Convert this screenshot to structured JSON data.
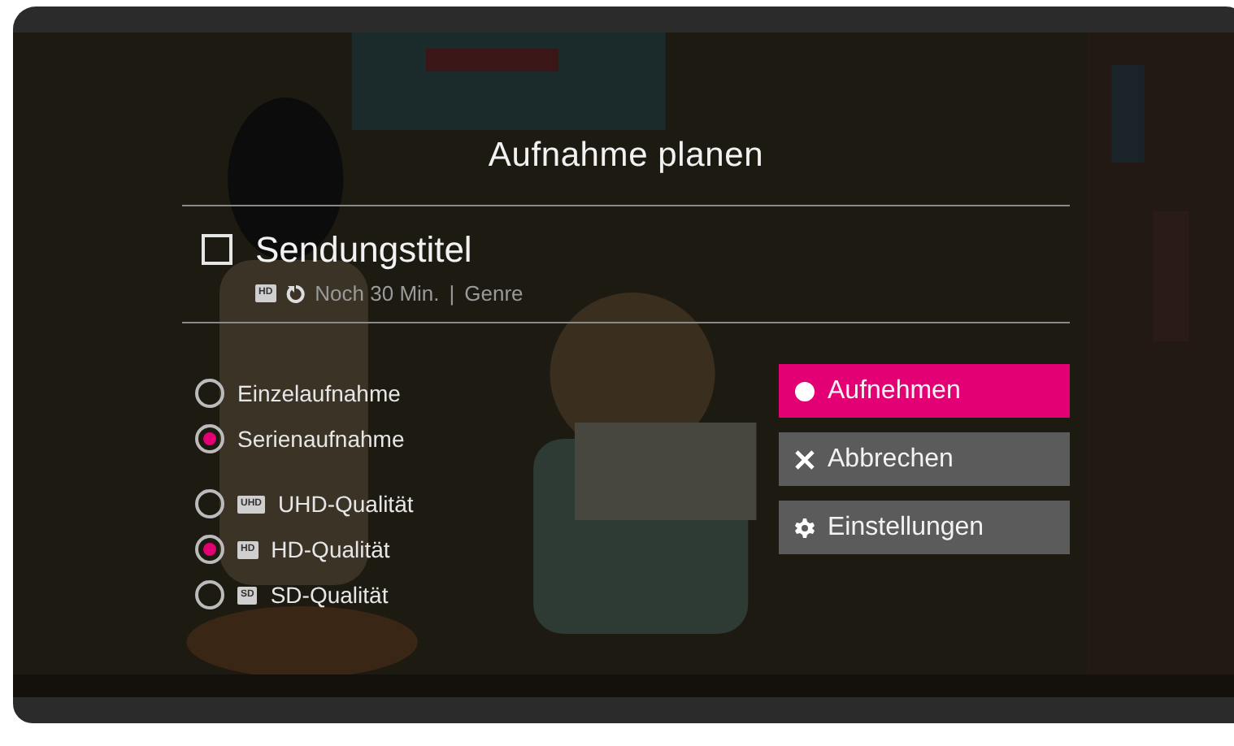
{
  "title": "Aufnahme planen",
  "program": {
    "checked": false,
    "title": "Sendungstitel",
    "badge": "HD",
    "remaining": "Noch 30 Min.",
    "separator": "|",
    "genre": "Genre"
  },
  "recording_types": [
    {
      "label": "Einzelaufnahme",
      "selected": false
    },
    {
      "label": "Serienaufnahme",
      "selected": true
    }
  ],
  "qualities": [
    {
      "badge": "UHD",
      "label": "UHD-Qualität",
      "selected": false
    },
    {
      "badge": "HD",
      "label": "HD-Qualität",
      "selected": true
    },
    {
      "badge": "SD",
      "label": "SD-Qualität",
      "selected": false
    }
  ],
  "buttons": [
    {
      "kind": "record",
      "label": "Aufnehmen",
      "selected": true
    },
    {
      "kind": "cancel",
      "label": "Abbrechen",
      "selected": false
    },
    {
      "kind": "settings",
      "label": "Einstellungen",
      "selected": false
    }
  ]
}
